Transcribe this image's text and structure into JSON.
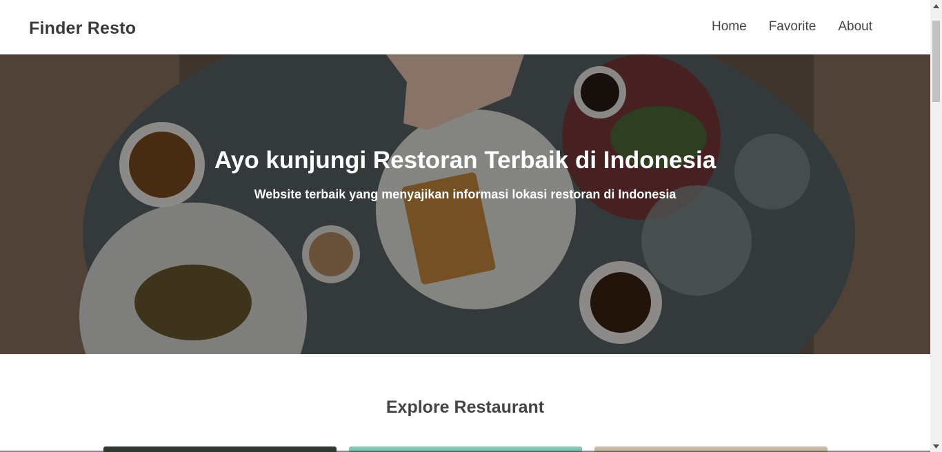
{
  "header": {
    "brand": "Finder Resto",
    "nav": [
      {
        "label": "Home"
      },
      {
        "label": "Favorite"
      },
      {
        "label": "About"
      }
    ]
  },
  "hero": {
    "title": "Ayo kunjungi Restoran Terbaik di Indonesia",
    "subtitle": "Website terbaik yang menyajikan informasi lokasi restoran di Indonesia"
  },
  "main": {
    "section_title": "Explore Restaurant"
  },
  "icons": {
    "scroll_up": "chevron-up-icon",
    "scroll_down": "chevron-down-icon"
  },
  "colors": {
    "overlay": "#000000",
    "text_dark": "#444444"
  }
}
